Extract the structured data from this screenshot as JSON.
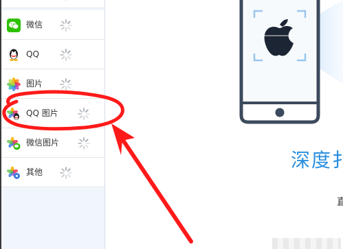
{
  "sidebar": {
    "items": [
      {
        "label": "",
        "icon": "wechat-icon",
        "status": "loading"
      },
      {
        "label": "微信",
        "icon": "wechat-icon",
        "status": "loading"
      },
      {
        "label": "QQ",
        "icon": "qq-icon",
        "status": "loading"
      },
      {
        "label": "图片",
        "icon": "photos-icon",
        "status": "loading"
      },
      {
        "label": "QQ 图片",
        "icon": "qq-photos-icon",
        "status": "loading"
      },
      {
        "label": "微信图片",
        "icon": "wechat-photos-icon",
        "status": "loading"
      },
      {
        "label": "其他",
        "icon": "other-icon",
        "status": "loading"
      }
    ]
  },
  "main": {
    "heading_fragment": "深度扌",
    "text_fragment": "直"
  },
  "annotation": {
    "color": "#ff1a1a",
    "shape": "circle-with-arrow",
    "target": "QQ 图片"
  },
  "colors": {
    "accent": "#2a8fe0",
    "sidebar_bg": "#f1f6fc",
    "wechat_green": "#2dc100",
    "phone_border": "#3b4a5c"
  }
}
